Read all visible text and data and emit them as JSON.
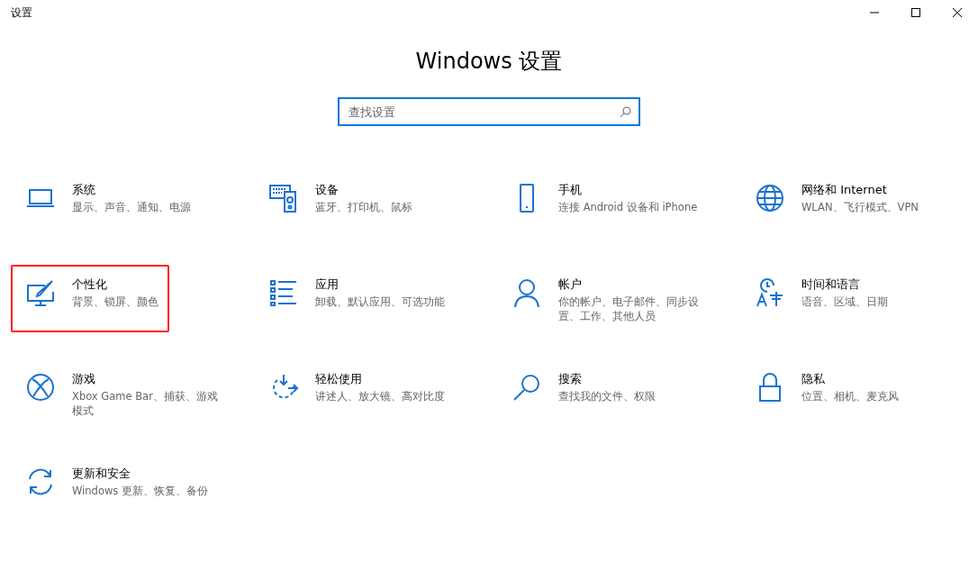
{
  "window": {
    "title": "设置"
  },
  "heading": "Windows 设置",
  "search": {
    "placeholder": "查找设置"
  },
  "items": [
    {
      "title": "系统",
      "description": "显示、声音、通知、电源",
      "highlighted": false
    },
    {
      "title": "设备",
      "description": "蓝牙、打印机、鼠标",
      "highlighted": false
    },
    {
      "title": "手机",
      "description": "连接 Android 设备和 iPhone",
      "highlighted": false
    },
    {
      "title": "网络和 Internet",
      "description": "WLAN、飞行模式、VPN",
      "highlighted": false
    },
    {
      "title": "个性化",
      "description": "背景、锁屏、颜色",
      "highlighted": true
    },
    {
      "title": "应用",
      "description": "卸载、默认应用、可选功能",
      "highlighted": false
    },
    {
      "title": "帐户",
      "description": "你的帐户、电子邮件、同步设置、工作、其他人员",
      "highlighted": false
    },
    {
      "title": "时间和语言",
      "description": "语音、区域、日期",
      "highlighted": false
    },
    {
      "title": "游戏",
      "description": "Xbox Game Bar、捕获、游戏模式",
      "highlighted": false
    },
    {
      "title": "轻松使用",
      "description": "讲述人、放大镜、高对比度",
      "highlighted": false
    },
    {
      "title": "搜索",
      "description": "查找我的文件、权限",
      "highlighted": false
    },
    {
      "title": "隐私",
      "description": "位置、相机、麦克风",
      "highlighted": false
    },
    {
      "title": "更新和安全",
      "description": "Windows 更新、恢复、备份",
      "highlighted": false
    }
  ]
}
